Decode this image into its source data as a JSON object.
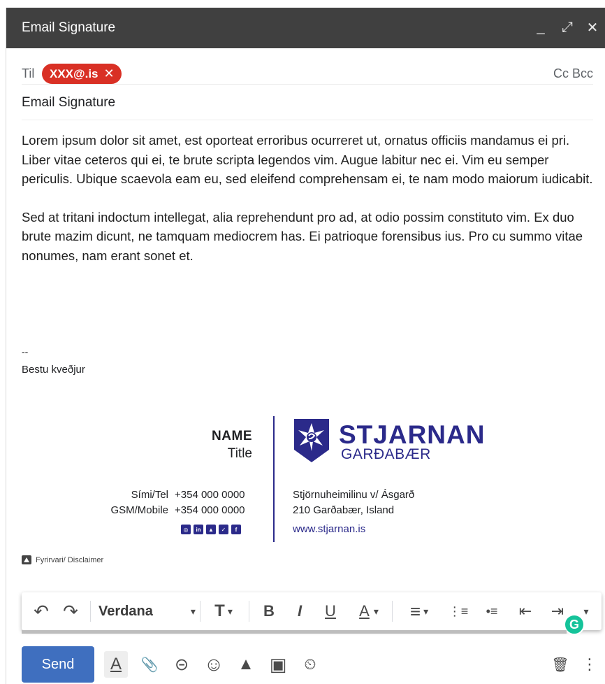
{
  "window": {
    "title": "Email Signature",
    "controls": {
      "minimize": "_",
      "expand": "⤢",
      "close": "✕"
    }
  },
  "recipients": {
    "to_label": "Til",
    "chip_email": "XXX@.is",
    "chip_remove": "✕",
    "cc_bcc": "Cc Bcc"
  },
  "subject": "Email Signature",
  "body": {
    "paragraph1": "Lorem ipsum dolor sit amet, est oporteat erroribus ocurreret ut, ornatus officiis mandamus ei pri. Liber vitae ceteros qui ei, te brute scripta legendos vim. Augue labitur nec ei. Vim eu semper periculis. Ubique scaevola eam eu, sed eleifend comprehensam ei, te nam modo maiorum iudicabit.",
    "paragraph2": "Sed at tritani indoctum intellegat, alia reprehendunt pro ad, at odio possim constituto vim. Ex duo brute mazim dicunt, ne tamquam mediocrem has. Ei patrioque forensibus ius. Pro cu summo vitae nonumes, nam erant sonet et."
  },
  "signature": {
    "dashes": "--",
    "regards": "Bestu kveðjur",
    "name": "NAME",
    "title": "Title",
    "phone_label": "Sími/Tel",
    "phone": "+354 000 0000",
    "mobile_label": "GSM/Mobile",
    "mobile": "+354 000 0000",
    "social_icons": [
      "instagram-icon",
      "linkedin-icon",
      "snapchat-icon",
      "twitter-icon",
      "facebook-icon"
    ],
    "social_glyphs": [
      "◎",
      "in",
      "▲",
      "✓",
      "f"
    ],
    "logo_name": "STJARNAN",
    "logo_sub": "GARÐABÆR",
    "address_line1": "Stjörnuheimilinu v/ Ásgarð",
    "address_line2": "210 Garðabær, Island",
    "website": "www.stjarnan.is",
    "brand_color": "#2b2a8a"
  },
  "disclaimer": "Fyrirvari/ Disclaimer",
  "toolbar": {
    "undo": "↶",
    "redo": "↷",
    "font": "Verdana",
    "dropdown": "▾",
    "text_size": "T",
    "bold": "B",
    "italic": "I",
    "underline": "U",
    "text_color": "A",
    "align": "≡",
    "numbered_list": "⋮≡",
    "bulleted_list": "•≡",
    "indent_less": "⇤",
    "indent_more": "⇥",
    "grammarly": "G"
  },
  "bottom_bar": {
    "send_label": "Send",
    "formatting": "A",
    "attach": "📎",
    "link": "⊝",
    "emoji": "☺",
    "drive": "▲",
    "photo": "▣",
    "confidential": "⏲",
    "trash": "🗑",
    "more": "⋮"
  },
  "colors": {
    "titlebar": "#404040",
    "chip": "#d93025",
    "send": "#3f6fbf",
    "grammarly": "#15c39a"
  }
}
